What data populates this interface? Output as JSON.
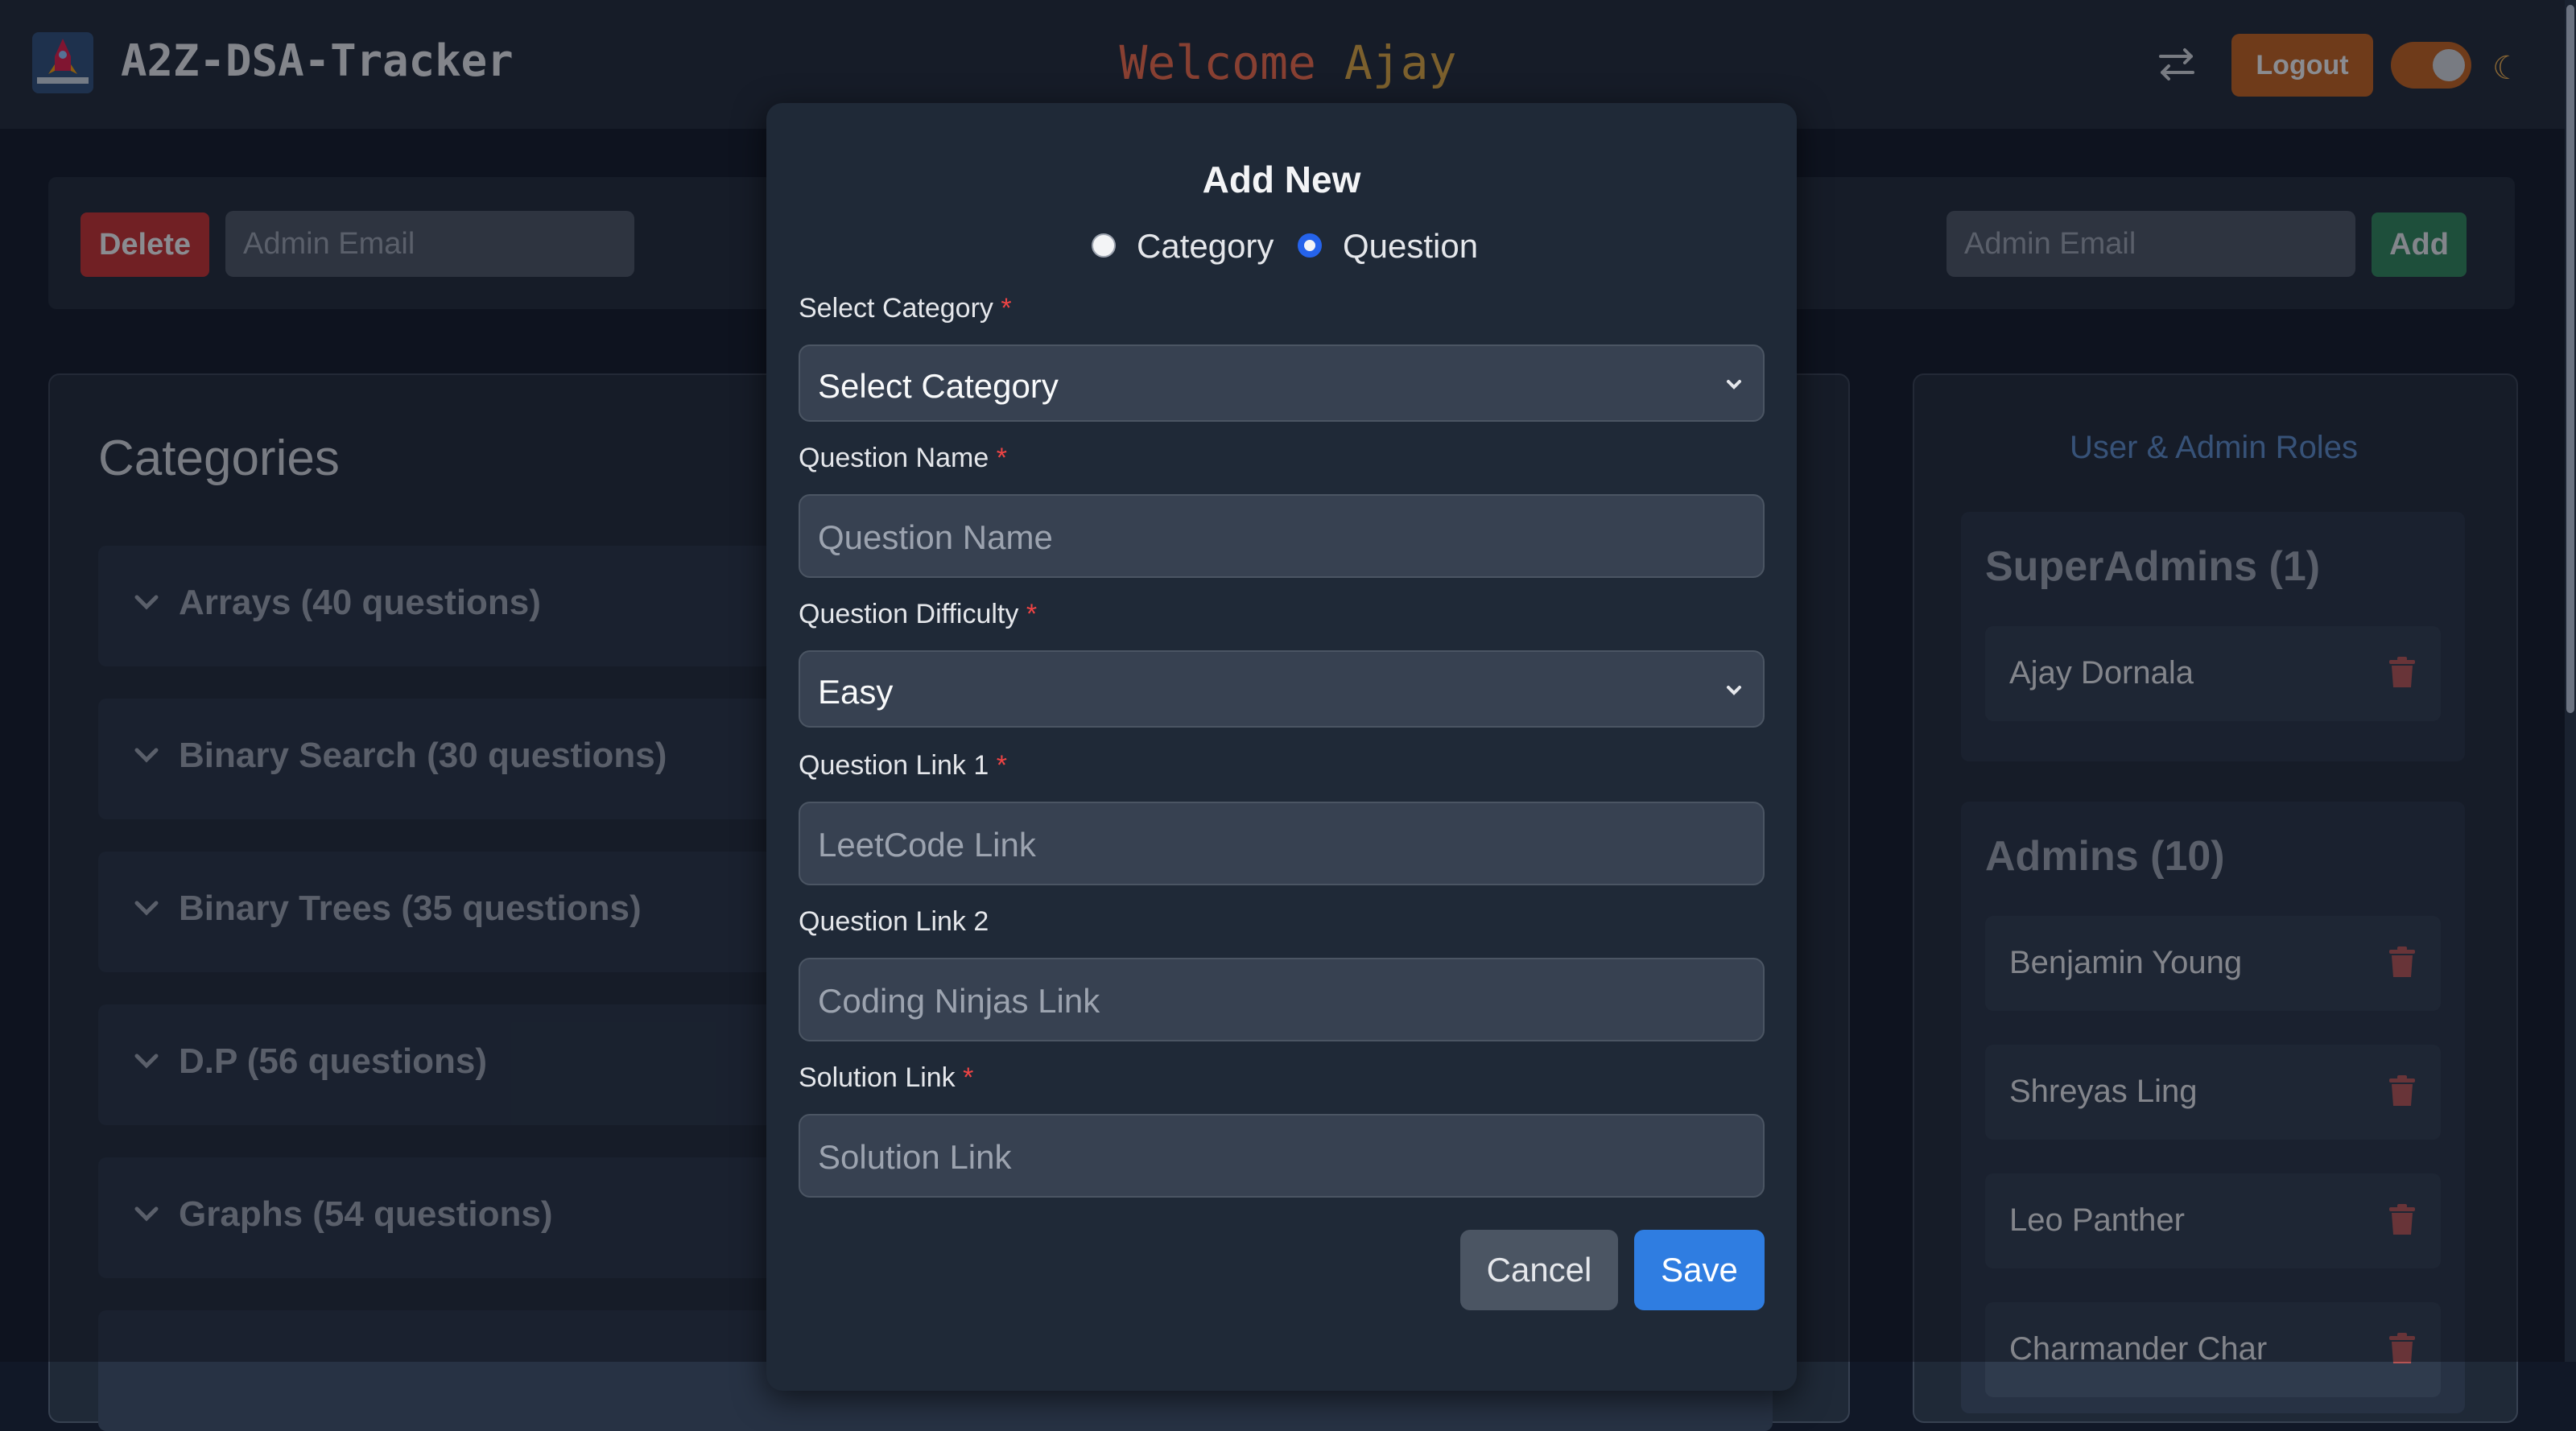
{
  "header": {
    "app_title": "A2Z-DSA-Tracker",
    "welcome_prefix": "Welcome",
    "welcome_name": "Ajay",
    "logout_label": "Logout",
    "theme_toggle": "dark"
  },
  "admin_bar": {
    "delete_label": "Delete",
    "delete_email_placeholder": "Admin Email",
    "add_email_placeholder": "Admin Email",
    "add_label": "Add"
  },
  "categories": {
    "title": "Categories",
    "items": [
      {
        "label": "Arrays (40 questions)"
      },
      {
        "label": "Binary Search (30 questions)"
      },
      {
        "label": "Binary Trees (35 questions)"
      },
      {
        "label": "D.P (56 questions)"
      },
      {
        "label": "Graphs (54 questions)"
      }
    ]
  },
  "roles": {
    "title": "User & Admin Roles",
    "superadmins": {
      "title": "SuperAdmins (1)",
      "members": [
        "Ajay Dornala"
      ]
    },
    "admins": {
      "title": "Admins (10)",
      "members": [
        "Benjamin Young",
        "Shreyas Ling",
        "Leo Panther",
        "Charmander Char"
      ]
    }
  },
  "modal": {
    "title": "Add New",
    "radio_category": "Category",
    "radio_question": "Question",
    "selected_type": "Question",
    "fields": {
      "select_category": {
        "label": "Select Category",
        "value": "Select Category"
      },
      "question_name": {
        "label": "Question Name",
        "placeholder": "Question Name"
      },
      "difficulty": {
        "label": "Question Difficulty",
        "value": "Easy"
      },
      "link1": {
        "label": "Question Link 1",
        "placeholder": "LeetCode Link"
      },
      "link2": {
        "label": "Question Link 2",
        "placeholder": "Coding Ninjas Link"
      },
      "solution": {
        "label": "Solution Link",
        "placeholder": "Solution Link"
      }
    },
    "required_mark": "*",
    "cancel_label": "Cancel",
    "save_label": "Save"
  },
  "colors": {
    "accent": "#2f7de1",
    "logout": "#c2611e",
    "delete": "#c53030",
    "add": "#2f855a"
  }
}
